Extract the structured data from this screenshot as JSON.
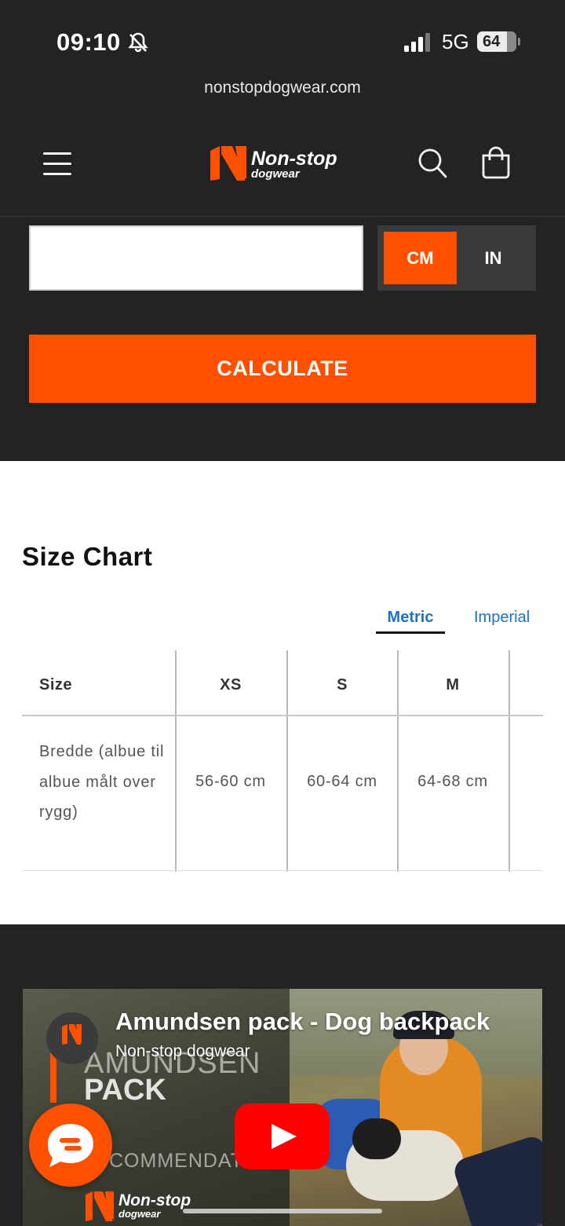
{
  "status_bar": {
    "time": "09:10",
    "network": "5G",
    "battery": "64"
  },
  "browser": {
    "url": "nonstopdogwear.com"
  },
  "header": {
    "brand_name": "Non-stop",
    "brand_sub": "dogwear"
  },
  "calculator": {
    "input_value": "",
    "units": [
      "CM",
      "IN"
    ],
    "selected_unit": "CM",
    "calculate_label": "CALCULATE"
  },
  "size_chart": {
    "title": "Size Chart",
    "tabs": [
      "Metric",
      "Imperial"
    ],
    "active_tab": "Metric",
    "headers": [
      "Size",
      "XS",
      "S",
      "M"
    ],
    "rows": [
      {
        "label": "Bredde (albue til albue målt over rygg)",
        "values": [
          "56-60 cm",
          "60-64 cm",
          "64-68 cm"
        ]
      }
    ]
  },
  "video": {
    "title": "Amundsen pack - Dog backpack",
    "channel": "Non-stop dogwear",
    "overlay_line1": "AMUNDSEN",
    "overlay_line2": "PACK",
    "overlay_line3": "COMMENDATIO"
  },
  "colors": {
    "accent": "#ff5000",
    "dark_bg": "#232323",
    "link": "#1a73c8"
  },
  "icons": [
    "bell-slash-icon",
    "signal-icon",
    "hamburger-menu-icon",
    "search-icon",
    "shopping-bag-icon",
    "play-icon",
    "chat-icon"
  ]
}
